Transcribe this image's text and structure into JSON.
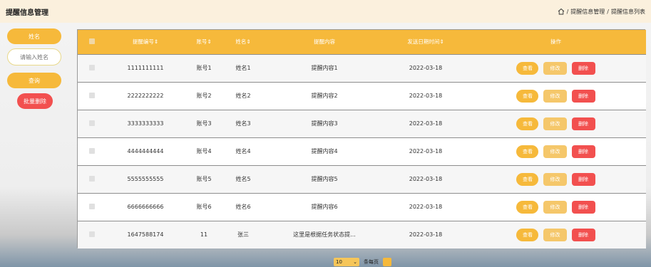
{
  "header": {
    "title": "提醒信息管理",
    "breadcrumb": [
      "提醒信息管理",
      "提醒信息列表"
    ]
  },
  "sidebar": {
    "name_label": "姓名",
    "name_placeholder": "请输入姓名",
    "query_label": "查询",
    "batch_delete_label": "批量删除"
  },
  "table": {
    "columns": [
      "提醒编号⇕",
      "账号⇕",
      "姓名⇕",
      "提醒内容",
      "发送日期时间⇕",
      "操作"
    ],
    "actions": {
      "view": "查看",
      "edit": "修改",
      "delete": "删除"
    },
    "rows": [
      {
        "id": "1111111111",
        "account": "账号1",
        "name": "姓名1",
        "content": "提醒内容1",
        "date": "2022-03-18"
      },
      {
        "id": "2222222222",
        "account": "账号2",
        "name": "姓名2",
        "content": "提醒内容2",
        "date": "2022-03-18"
      },
      {
        "id": "3333333333",
        "account": "账号3",
        "name": "姓名3",
        "content": "提醒内容3",
        "date": "2022-03-18"
      },
      {
        "id": "4444444444",
        "account": "账号4",
        "name": "姓名4",
        "content": "提醒内容4",
        "date": "2022-03-18"
      },
      {
        "id": "5555555555",
        "account": "账号5",
        "name": "姓名5",
        "content": "提醒内容5",
        "date": "2022-03-18"
      },
      {
        "id": "6666666666",
        "account": "账号6",
        "name": "姓名6",
        "content": "提醒内容6",
        "date": "2022-03-18"
      },
      {
        "id": "1647588174",
        "account": "11",
        "name": "张三",
        "content": "这里是根据任务状态提...",
        "date": "2022-03-18"
      }
    ]
  },
  "pager": {
    "page_size": "10",
    "per_page_label": "条每页"
  },
  "colors": {
    "accent": "#f6b93b",
    "danger": "#f2504f",
    "header_bg": "#fbf0dd"
  }
}
